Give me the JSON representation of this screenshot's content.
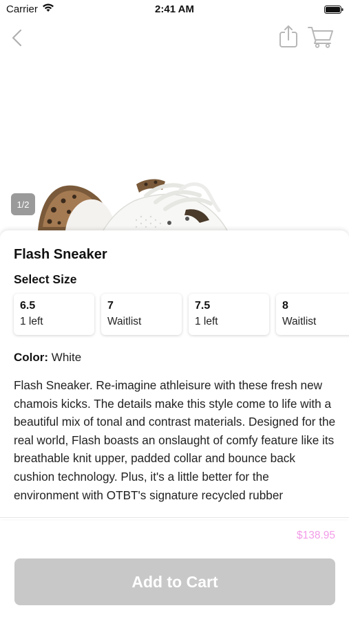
{
  "status_bar": {
    "carrier": "Carrier",
    "time": "2:41 AM",
    "icons": [
      "wifi-icon",
      "battery-icon"
    ]
  },
  "nav": {
    "icons": [
      "back-chevron-icon",
      "share-icon",
      "cart-icon"
    ]
  },
  "image": {
    "counter": "1/2"
  },
  "product": {
    "title": "Flash Sneaker",
    "size_heading": "Select Size",
    "sizes": [
      {
        "size": "6.5",
        "stock": "1 left"
      },
      {
        "size": "7",
        "stock": "Waitlist"
      },
      {
        "size": "7.5",
        "stock": "1 left"
      },
      {
        "size": "8",
        "stock": "Waitlist"
      }
    ],
    "color_label": "Color:",
    "color_value": "White",
    "description": "Flash Sneaker. Re-imagine athleisure with these fresh new chamois kicks. The details make this style come to life with a beautiful mix of tonal and contrast materials. Designed for the real world, Flash boasts an onslaught of comfy feature like its breathable knit upper, padded collar and bounce back cushion technology. Plus, it's a little better for the environment with OTBT's signature recycled rubber"
  },
  "footer": {
    "price": "$138.95",
    "add_to_cart_label": "Add to Cart"
  },
  "colors": {
    "price": "#f29be8",
    "button_disabled": "#c8c8c8",
    "counter_badge": "#9a9a9a"
  }
}
